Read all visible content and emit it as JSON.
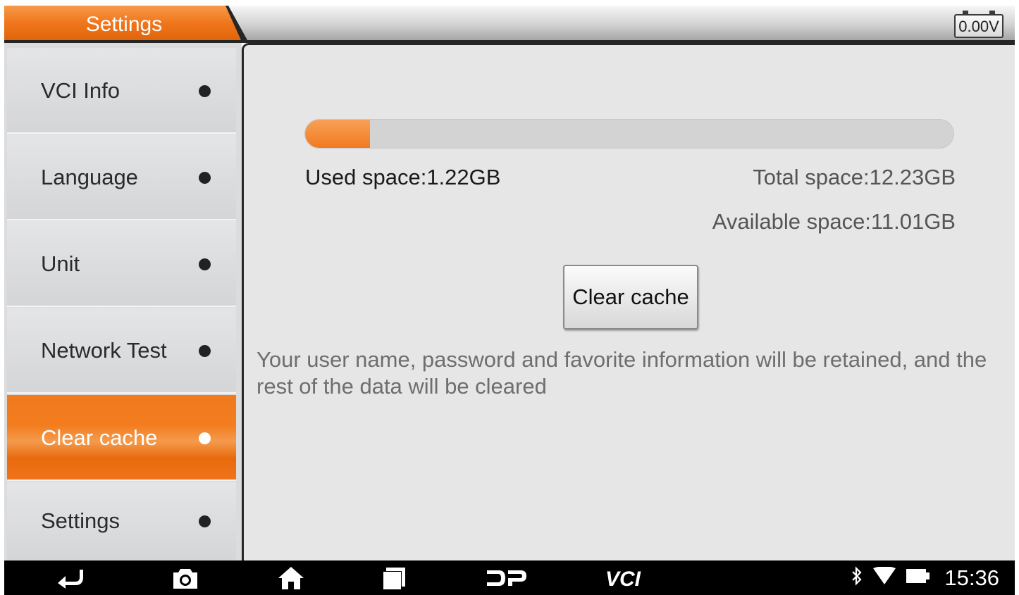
{
  "header": {
    "title": "Settings",
    "voltage": "0.00V",
    "accent_color": "#f07a1e"
  },
  "sidebar": {
    "items": [
      {
        "label": "VCI Info",
        "active": false
      },
      {
        "label": "Language",
        "active": false
      },
      {
        "label": "Unit",
        "active": false
      },
      {
        "label": "Network Test",
        "active": false
      },
      {
        "label": "Clear cache",
        "active": true
      },
      {
        "label": "Settings",
        "active": false
      }
    ]
  },
  "storage": {
    "used_label": "Used space:1.22GB",
    "total_label": "Total space:12.23GB",
    "available_label": "Available space:11.01GB",
    "used_fraction": 0.0998
  },
  "main": {
    "clear_button": "Clear cache",
    "notice": "Your user name, password and favorite information will be retained, and the rest of the data will be cleared"
  },
  "navbar": {
    "icons": [
      "back-icon",
      "camera-icon",
      "home-icon",
      "recent-apps-icon",
      "dp-icon",
      "vci-icon"
    ],
    "dp_label": "DP",
    "vci_label": "VCI",
    "status_icons": [
      "bluetooth-icon",
      "wifi-icon",
      "battery-icon"
    ],
    "time": "15:36"
  }
}
